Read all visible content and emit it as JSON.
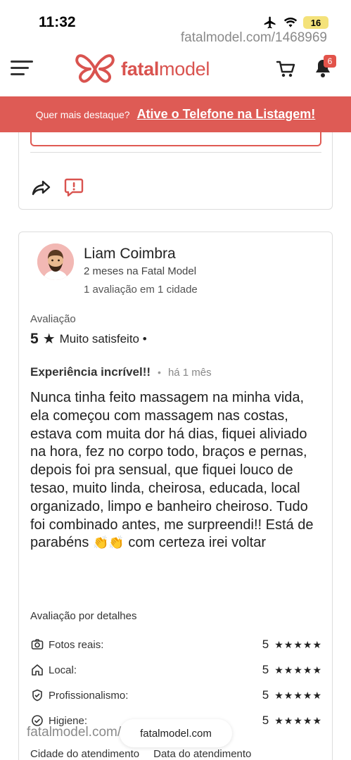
{
  "status_bar": {
    "time": "11:32",
    "battery": "16",
    "url_watermark": "fatalmodel.com/1468969"
  },
  "header": {
    "logo_text_bold": "fatal",
    "logo_text_light": "model",
    "notification_count": "6",
    "brand_color": "#d9534f"
  },
  "promo": {
    "text": "Quer mais destaque?",
    "link": "Ative o Telefone na Listagem!",
    "bg_color": "#de5b55"
  },
  "review": {
    "reviewer_name": "Liam Coimbra",
    "tenure": "2 meses na Fatal Model",
    "review_count": "1 avaliação em 1 cidade",
    "rating_label": "Avaliação",
    "rating_value": "5",
    "rating_text": "Muito satisfeito •",
    "title": "Experiência incrível!!",
    "date": "há 1 mês",
    "body_1": "Nunca tinha feito massagem na minha vida, ela começou com massagem nas costas, estava com muita dor há dias, fiquei aliviado na hora, fez no corpo todo, braços e pernas, depois foi pra sensual, que fiquei louco de tesao, muito linda, cheirosa, educada, local organizado, limpo e banheiro cheiroso. Tudo foi combinado antes, me surpreendi!! Está de parabéns",
    "body_2": "com certeza irei voltar",
    "details_label": "Avaliação por detalhes",
    "details": [
      {
        "name": "Fotos reais:",
        "score": "5",
        "stars": "★★★★★",
        "icon": "camera-check-icon"
      },
      {
        "name": "Local:",
        "score": "5",
        "stars": "★★★★★",
        "icon": "home-icon"
      },
      {
        "name": "Profissionalismo:",
        "score": "5",
        "stars": "★★★★★",
        "icon": "shield-check-icon"
      },
      {
        "name": "Higiene:",
        "score": "5",
        "stars": "★★★★★",
        "icon": "check-circle-icon"
      }
    ],
    "footer_col_1": "Cidade do atendimento",
    "footer_col_2": "Data do atendimento"
  },
  "bottom": {
    "url_watermark": "fatalmodel.com/1468969",
    "url_pill": "fatalmodel.com"
  }
}
